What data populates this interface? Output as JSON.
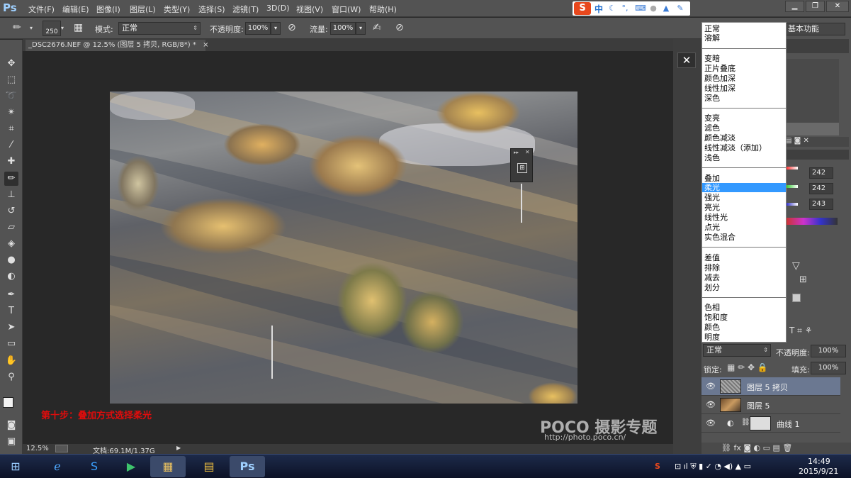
{
  "app": {
    "logo": "Ps"
  },
  "menu": [
    "文件(F)",
    "编辑(E)",
    "图像(I)",
    "图层(L)",
    "类型(Y)",
    "选择(S)",
    "滤镜(T)",
    "3D(D)",
    "视图(V)",
    "窗口(W)",
    "帮助(H)"
  ],
  "ime": {
    "logo": "S",
    "mode": "中"
  },
  "options": {
    "brush_size": "250",
    "mode_label": "模式:",
    "mode_value": "正常",
    "opacity_label": "不透明度:",
    "opacity_value": "100%",
    "flow_label": "流量:",
    "flow_value": "100%"
  },
  "workspace": "基本功能",
  "document": {
    "tab": "_DSC2676.NEF @ 12.5% (图层 5 拷贝, RGB/8*) *",
    "tab_close": "×"
  },
  "caption": "第十步：叠加方式选择柔光",
  "watermark": {
    "brand": "POCO 摄影专题",
    "url": "http://photo.poco.cn/"
  },
  "status": {
    "zoom": "12.5%",
    "doc": "文档:69.1M/1.37G"
  },
  "blend_modes": [
    [
      "正常",
      "溶解"
    ],
    [
      "变暗",
      "正片叠底",
      "颜色加深",
      "线性加深",
      "深色"
    ],
    [
      "变亮",
      "滤色",
      "颜色减淡",
      "线性减淡（添加）",
      "浅色"
    ],
    [
      "叠加",
      "柔光",
      "强光",
      "亮光",
      "线性光",
      "点光",
      "实色混合"
    ],
    [
      "差值",
      "排除",
      "减去",
      "划分"
    ],
    [
      "色相",
      "饱和度",
      "颜色",
      "明度"
    ]
  ],
  "selected_blend": "柔光",
  "rgb_values": [
    "242",
    "242",
    "243"
  ],
  "layers": {
    "blend_mode": "正常",
    "opacity_label": "不透明度:",
    "opacity": "100%",
    "lock_label": "锁定:",
    "fill_label": "填充:",
    "fill": "100%",
    "items": [
      {
        "name": "图层 5 拷贝",
        "selected": true
      },
      {
        "name": "图层 5",
        "selected": false
      },
      {
        "name": "曲线 1",
        "selected": false
      }
    ]
  },
  "clock": {
    "time": "14:49",
    "date": "2015/9/21"
  },
  "colors": {
    "accent": "#3399ff",
    "caption": "#e00c0c",
    "selected_layer": "#6b7891"
  }
}
